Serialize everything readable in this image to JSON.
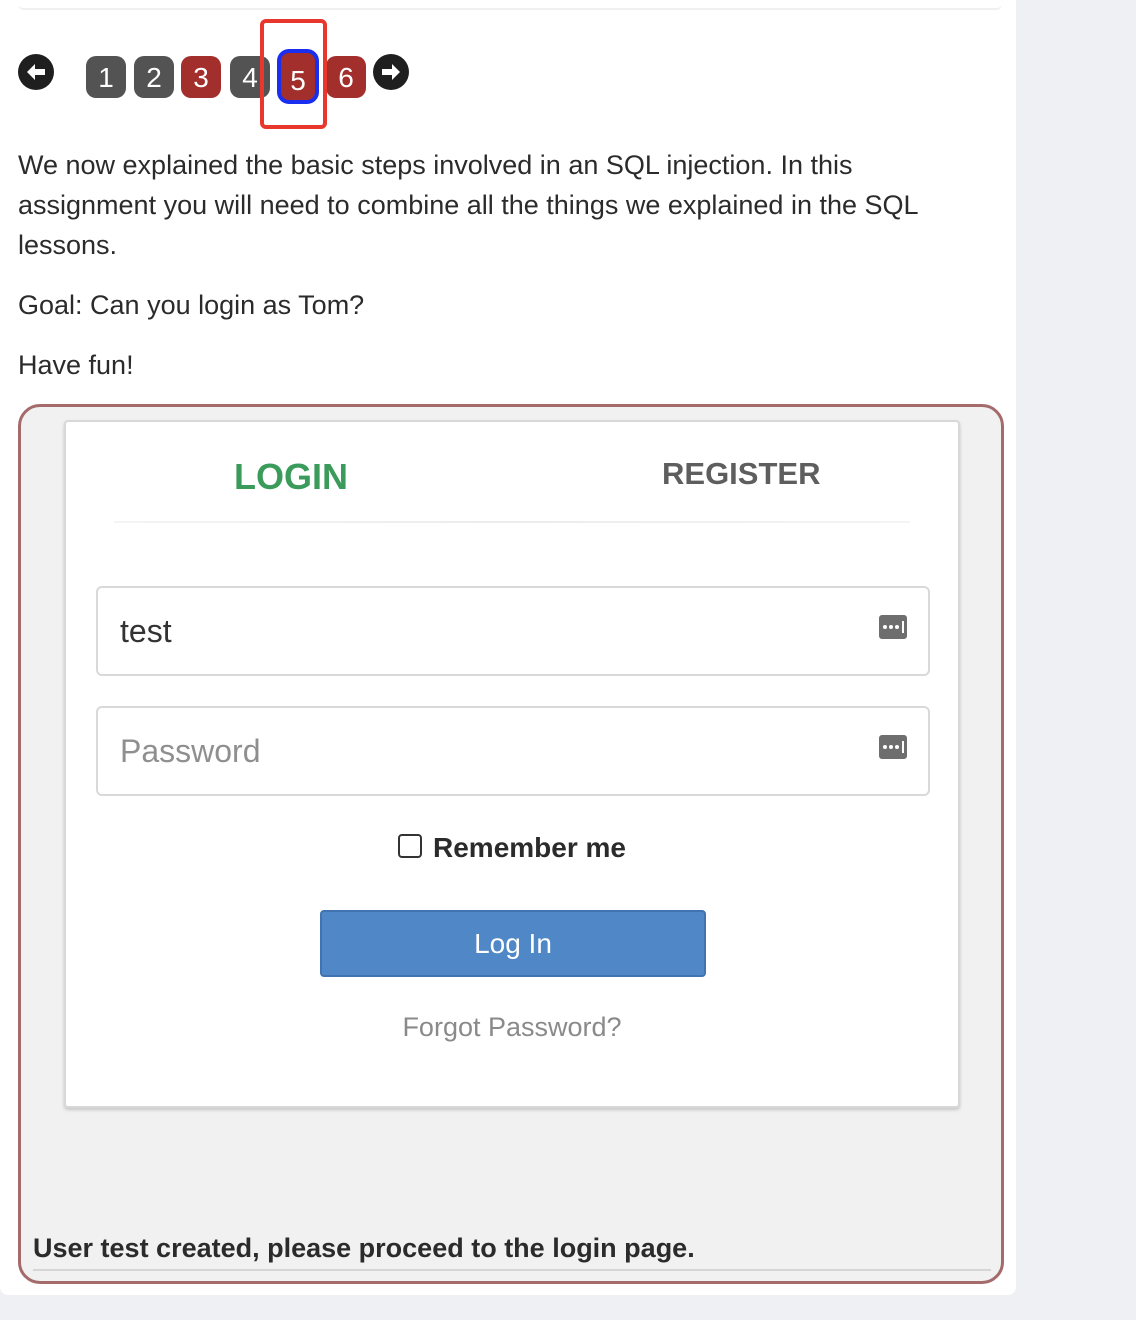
{
  "pagination": {
    "prev_icon": "arrow-left-icon",
    "next_icon": "arrow-right-icon",
    "pages": [
      {
        "label": "1",
        "status": "gray"
      },
      {
        "label": "2",
        "status": "gray"
      },
      {
        "label": "3",
        "status": "red"
      },
      {
        "label": "4",
        "status": "gray"
      },
      {
        "label": "5",
        "status": "red-current"
      },
      {
        "label": "6",
        "status": "red"
      }
    ],
    "current_page": "5"
  },
  "lesson": {
    "intro": "We now explained the basic steps involved in an SQL injection. In this assignment you will need to combine all the things we explained in the SQL lessons.",
    "goal": "Goal: Can you login as Tom?",
    "closing": "Have fun!"
  },
  "login_form": {
    "tabs": {
      "login": "LOGIN",
      "register": "REGISTER"
    },
    "username": {
      "value": "test",
      "icon": "password-key-icon"
    },
    "password": {
      "value": "",
      "placeholder": "Password",
      "icon": "password-key-icon"
    },
    "remember_label": "Remember me",
    "remember_checked": false,
    "submit_label": "Log In",
    "forgot_label": "Forgot Password?"
  },
  "feedback": {
    "message": "User test created, please proceed to the login page."
  },
  "colors": {
    "login_tab": "#3a9b5a",
    "submit_button": "#5087c6",
    "page_gray": "#535353",
    "page_red": "#a32f2c",
    "current_outline": "#1a2ef0",
    "highlight": "#e8372d",
    "assignment_border": "#a56b6b"
  }
}
